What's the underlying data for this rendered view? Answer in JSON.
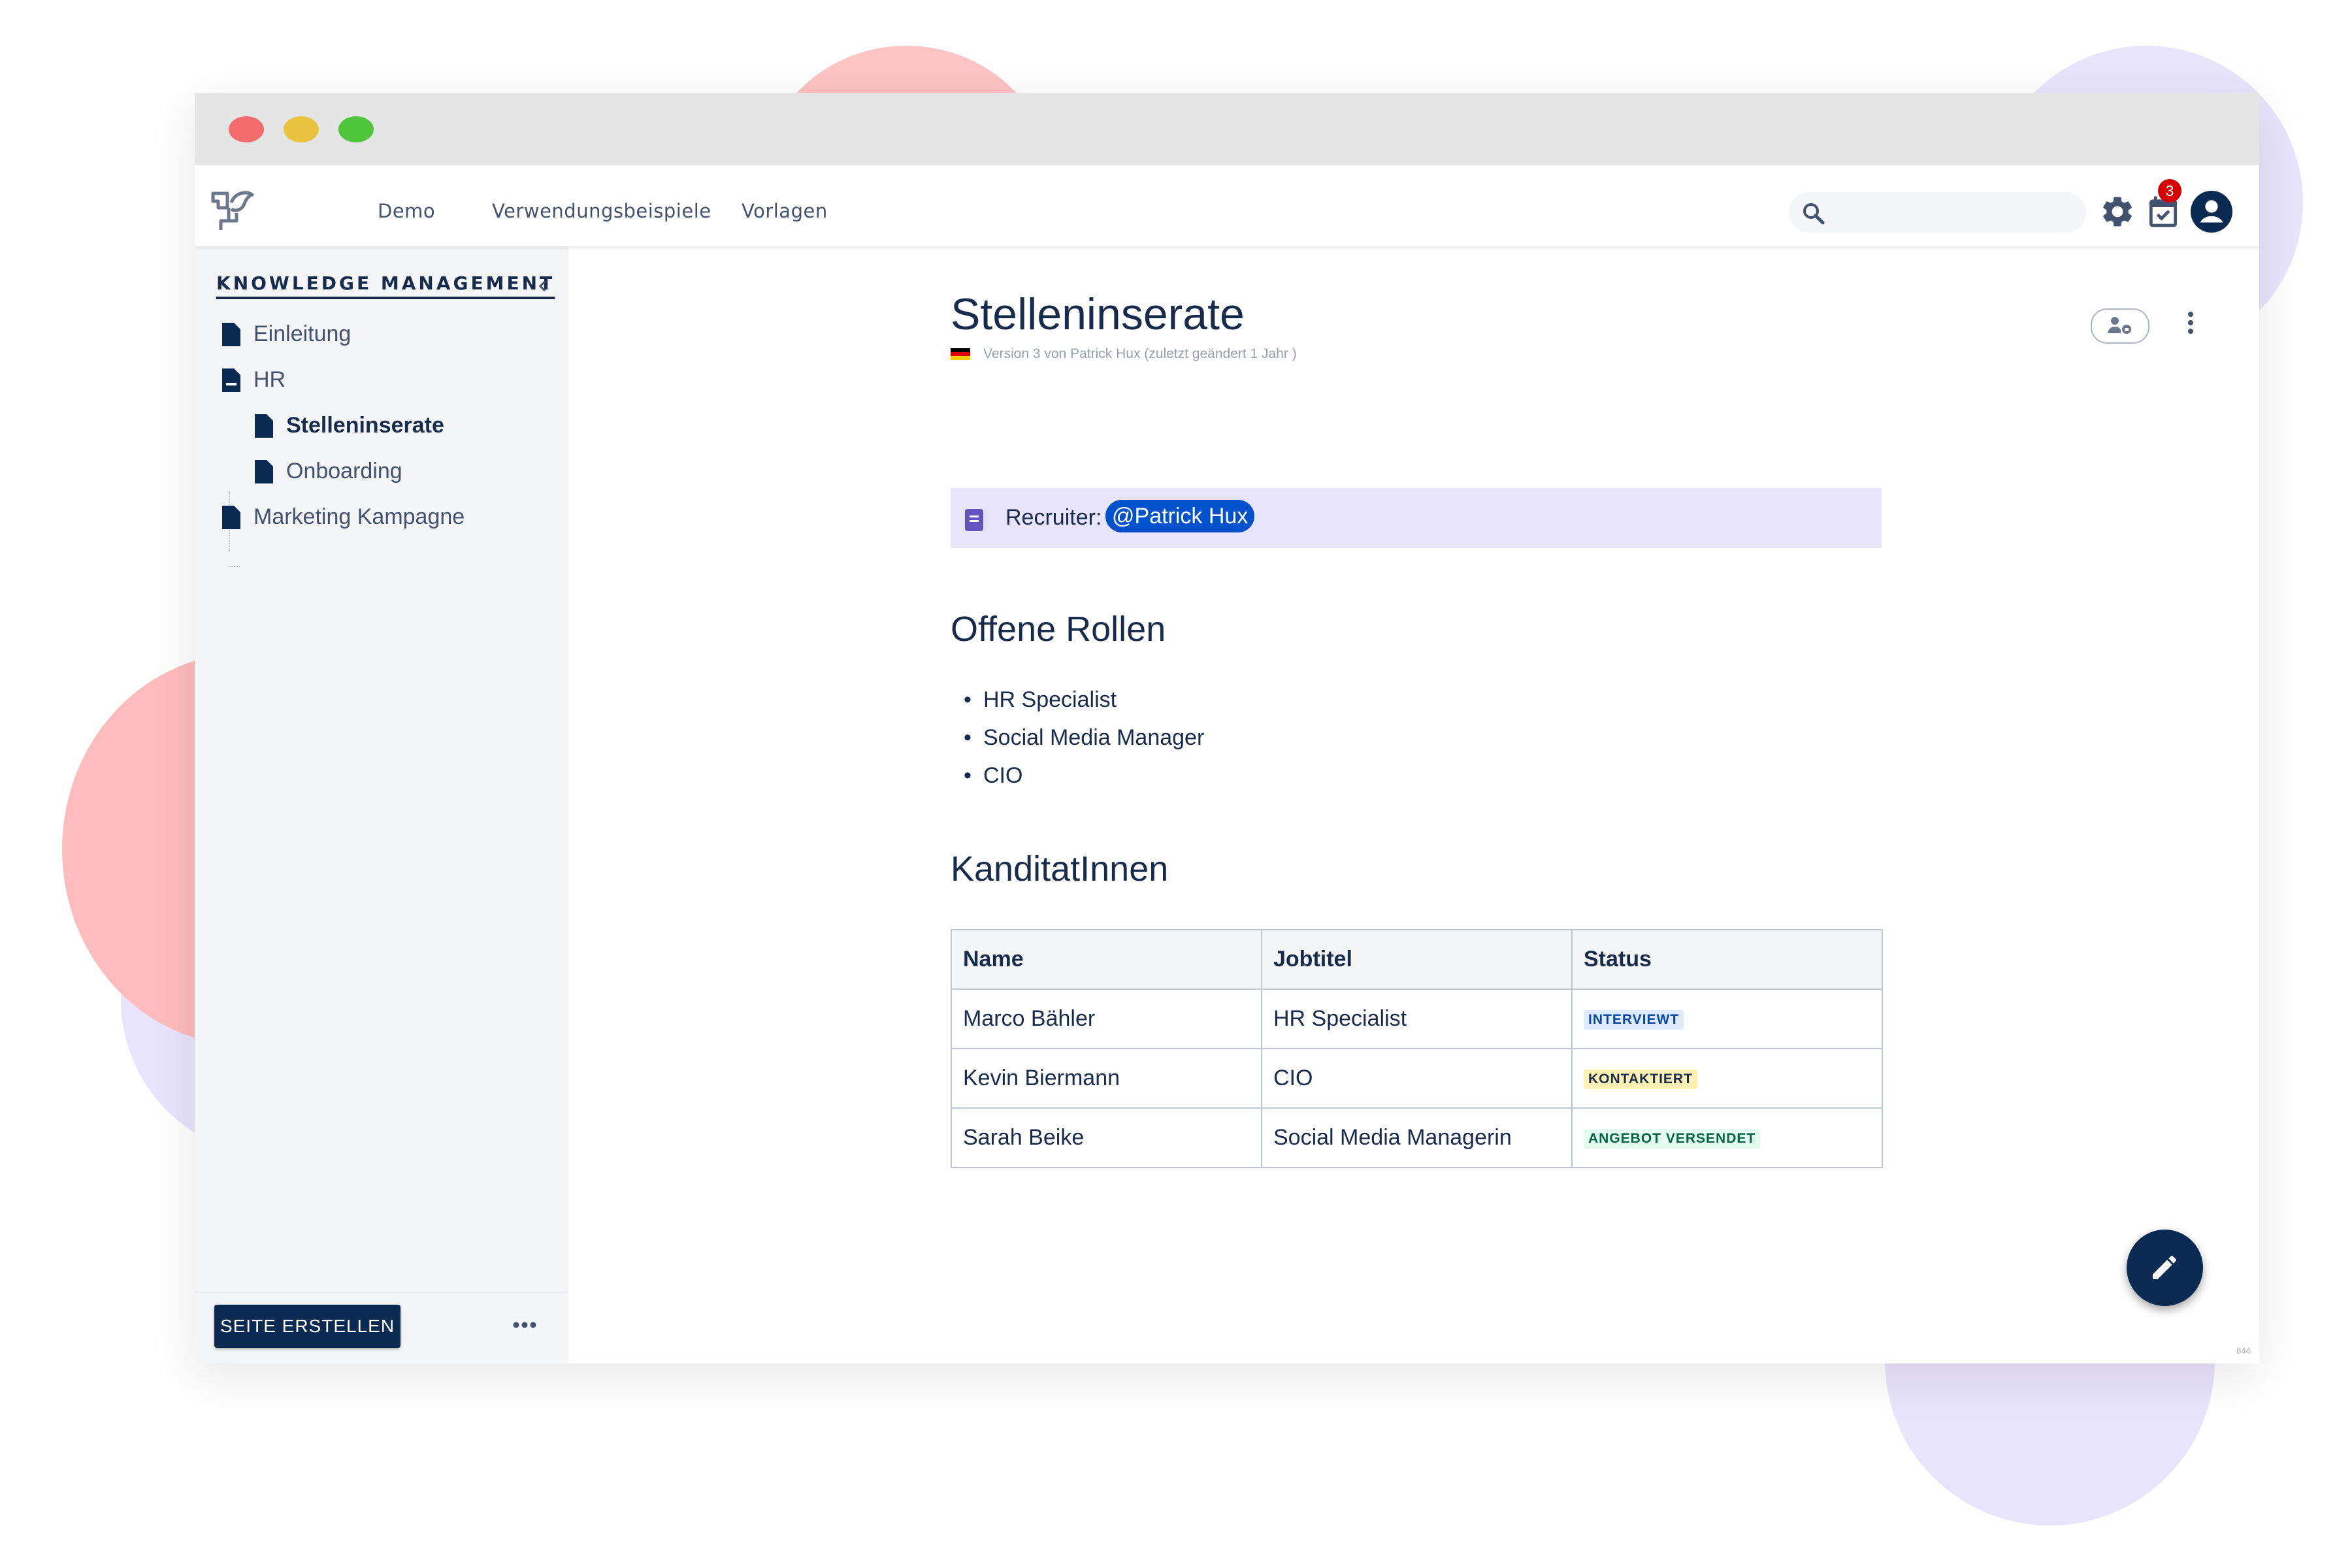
{
  "nav": {
    "items": [
      "Demo",
      "Verwendungsbeispiele",
      "Vorlagen"
    ],
    "search_placeholder": "",
    "notification_count": "3"
  },
  "sidebar": {
    "space_title": "KNOWLEDGE MANAGEMENT",
    "items": [
      {
        "label": "Einleitung"
      },
      {
        "label": "HR"
      },
      {
        "label": "Stelleninserate"
      },
      {
        "label": "Onboarding"
      },
      {
        "label": "Marketing Kampagne"
      }
    ],
    "create_button": "SEITE ERSTELLEN"
  },
  "page": {
    "title": "Stelleninserate",
    "meta": "Version 3 von Patrick Hux (zuletzt geändert 1 Jahr )",
    "recruiter_label": "Recruiter:",
    "recruiter_mention": "@Patrick Hux",
    "section1": "Offene Rollen",
    "roles": [
      "HR Specialist",
      "Social Media Manager",
      "CIO"
    ],
    "section2": "KanditatInnen",
    "table": {
      "headers": [
        "Name",
        "Jobtitel",
        "Status"
      ],
      "rows": [
        {
          "name": "Marco Bähler",
          "job": "HR Specialist",
          "status": "INTERVIEWT",
          "status_color": "blue"
        },
        {
          "name": "Kevin Biermann",
          "job": "CIO",
          "status": "KONTAKTIERT",
          "status_color": "yellow"
        },
        {
          "name": "Sarah Beike",
          "job": "Social Media Managerin",
          "status": "ANGEBOT VERSENDET",
          "status_color": "green"
        }
      ]
    },
    "version_tiny": "844"
  },
  "colors": {
    "brand_navy": "#0b2a52",
    "mention_blue": "#0052cc",
    "panel_purple": "#e8e4fc"
  }
}
